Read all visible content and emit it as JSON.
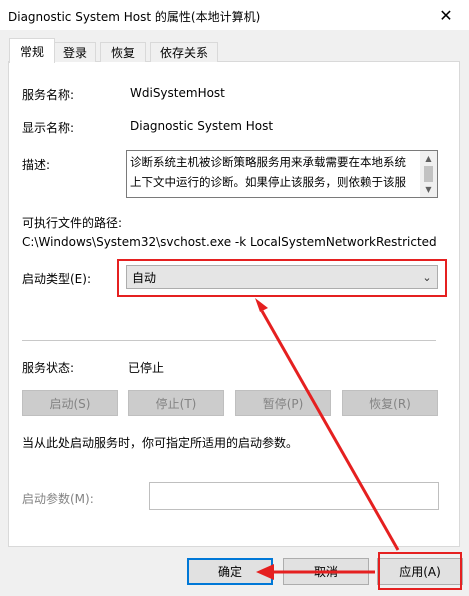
{
  "window": {
    "title": "Diagnostic System Host 的属性(本地计算机)",
    "close_glyph": "✕"
  },
  "tabs": [
    {
      "label": "常规"
    },
    {
      "label": "登录"
    },
    {
      "label": "恢复"
    },
    {
      "label": "依存关系"
    }
  ],
  "general": {
    "service_name_label": "服务名称:",
    "service_name": "WdiSystemHost",
    "display_name_label": "显示名称:",
    "display_name": "Diagnostic System Host",
    "description_label": "描述:",
    "description_line1": "诊断系统主机被诊断策略服务用来承载需要在本地系统",
    "description_line2": "上下文中运行的诊断。如果停止该服务，则依赖于该服",
    "exe_path_label": "可执行文件的路径:",
    "exe_path": "C:\\Windows\\System32\\svchost.exe -k LocalSystemNetworkRestricted",
    "startup_type_label": "启动类型(E):",
    "startup_type": "自动",
    "status_label": "服务状态:",
    "status": "已停止",
    "start_button": "启动(S)",
    "stop_button": "停止(T)",
    "pause_button": "暂停(P)",
    "resume_button": "恢复(R)",
    "hint": "当从此处启动服务时，你可指定所适用的启动参数。",
    "params_label": "启动参数(M):",
    "params_value": ""
  },
  "footer": {
    "ok": "确定",
    "cancel": "取消",
    "apply": "应用(A)"
  },
  "colors": {
    "annotation": "#e52020",
    "accent": "#0078d7"
  }
}
